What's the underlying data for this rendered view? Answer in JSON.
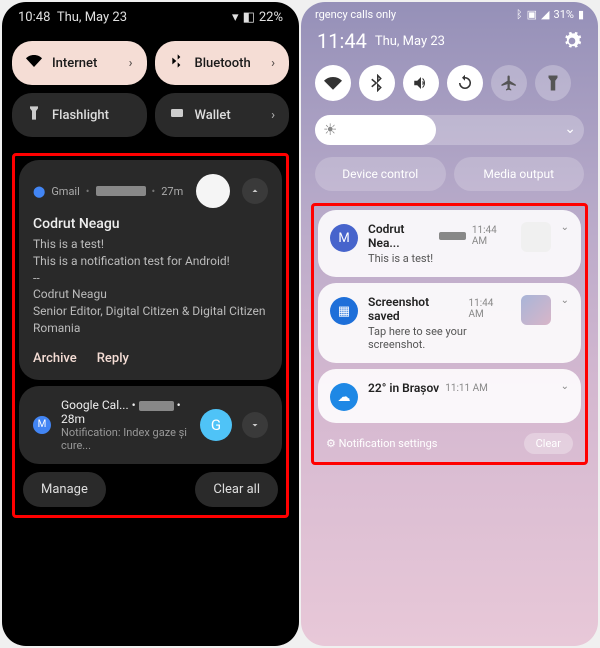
{
  "left": {
    "status": {
      "time": "10:48",
      "date": "Thu, May 23",
      "battery": "22%",
      "battery_icon": "🔋"
    },
    "tiles": [
      {
        "icon": "wifi",
        "label": "Internet",
        "active": true
      },
      {
        "icon": "bluetooth",
        "label": "Bluetooth",
        "active": true
      },
      {
        "icon": "flashlight",
        "label": "Flashlight",
        "active": false
      },
      {
        "icon": "wallet",
        "label": "Wallet",
        "active": false
      }
    ],
    "notifications": [
      {
        "app": "Gmail",
        "time": "27m",
        "sender": "Codrut Neagu",
        "subject": "This is a test!",
        "body": "This is a notification test for Android!\n--\nCodrut Neagu\nSenior Editor, Digital Citizen & Digital Citizen Romania",
        "actions": [
          "Archive",
          "Reply"
        ]
      },
      {
        "app": "Google Cal...",
        "time": "28m",
        "title": "Notification: Index gaze și cure...",
        "avatar_letter": "G"
      }
    ],
    "buttons": {
      "manage": "Manage",
      "clear_all": "Clear all"
    }
  },
  "right": {
    "status": {
      "carrier": "rgency calls only",
      "signal": "31%"
    },
    "time": "11:44",
    "date": "Thu, May 23",
    "qs_icons": [
      "wifi",
      "bluetooth",
      "sound",
      "rotate",
      "airplane",
      "flashlight"
    ],
    "brightness_pct": 45,
    "chips": [
      "Device control",
      "Media output"
    ],
    "notifications": [
      {
        "icon_bg": "#4764cc",
        "icon": "M",
        "title": "Codrut Nea...",
        "time": "11:44 AM",
        "body": "This is a test!",
        "has_thumb": true
      },
      {
        "icon_bg": "#1e6fd9",
        "icon": "▦",
        "title": "Screenshot saved",
        "time": "11:44 AM",
        "body": "Tap here to see your screenshot.",
        "has_thumb": true
      },
      {
        "icon_bg": "#1e88e5",
        "icon": "☁",
        "title": "22° in Brașov",
        "time": "11:11 AM",
        "body": "",
        "has_thumb": false
      }
    ],
    "footer": {
      "settings": "Notification settings",
      "clear": "Clear"
    }
  }
}
